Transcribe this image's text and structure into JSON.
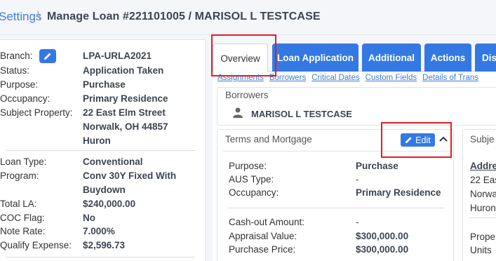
{
  "header": {
    "breadcrumb_link": "Settings",
    "separator": "\\",
    "title": "Manage Loan #221101005 / MARISOL L TESTCASE"
  },
  "summary": {
    "rows": [
      {
        "label": "Branch:",
        "value": "LPA-URLA2021"
      },
      {
        "label": "Status:",
        "value": "Application Taken"
      },
      {
        "label": "Purpose:",
        "value": "Purchase"
      },
      {
        "label": "Occupancy:",
        "value": "Primary Residence"
      },
      {
        "label": "Subject Property:",
        "value": "22 East Elm Street",
        "value2": "Norwalk, OH 44857",
        "value3": "Huron"
      },
      {
        "label": "Loan Type:",
        "value": "Conventional"
      },
      {
        "label": "Program:",
        "value": "Conv 30Y Fixed With",
        "value2": "Buydown"
      },
      {
        "label": "Total LA:",
        "value": "$240,000.00"
      },
      {
        "label": "COC Flag:",
        "value": "No"
      },
      {
        "label": "Note Rate:",
        "value": "7.000%"
      },
      {
        "label": "Qualify Expense:",
        "value": "$2,596.73"
      }
    ]
  },
  "tabs": [
    {
      "label": "Overview",
      "active": true
    },
    {
      "label": "Loan Application"
    },
    {
      "label": "Additional"
    },
    {
      "label": "Actions"
    },
    {
      "label": "Dis"
    }
  ],
  "sublinks": [
    "Assignments",
    "Borrowers",
    "Critical Dates",
    "Custom Fields",
    "Details of Trans"
  ],
  "borrowers": {
    "title": "Borrowers",
    "name": "MARISOL L TESTCASE"
  },
  "terms": {
    "title": "Terms and Mortgage",
    "edit_label": "Edit",
    "rows": [
      {
        "label": "Purpose:",
        "value": "Purchase"
      },
      {
        "label": "AUS Type:",
        "value": "-"
      },
      {
        "label": "Occupancy:",
        "value": "Primary Residence"
      },
      {
        "label": "Cash-out Amount:",
        "value": "-"
      },
      {
        "label": "Appraisal Value:",
        "value": "$300,000.00"
      },
      {
        "label": "Purchase Price:",
        "value": "$300,000.00"
      }
    ]
  },
  "subject": {
    "title": "Subje",
    "address_head": "Addre",
    "lines": [
      "22 Eas",
      "Norwa",
      "Huron"
    ],
    "lines2": [
      "Prope",
      "Units"
    ]
  },
  "colors": {
    "accent": "#3479e3",
    "link": "#3b7dd8",
    "highlight": "#e41b23"
  }
}
